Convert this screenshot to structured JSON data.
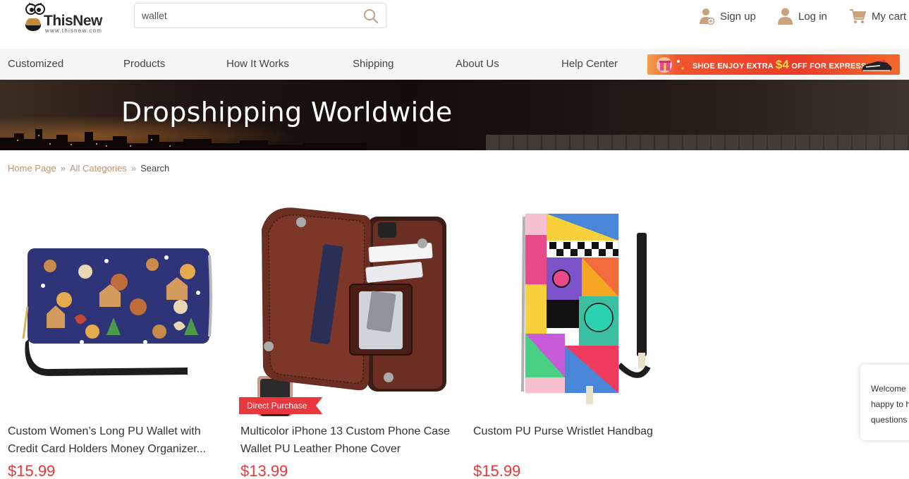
{
  "header": {
    "logo_brand": "ThisNew",
    "logo_url": "www.thisnew.com",
    "search_value": "wallet",
    "sign_up": "Sign up",
    "log_in": "Log in",
    "my_cart": "My cart"
  },
  "nav": {
    "items": [
      "Customized",
      "Products",
      "How It Works",
      "Shipping",
      "About Us",
      "Help Center"
    ],
    "promo": {
      "text_before": "SHOE ENJOY EXTRA ",
      "amount": "$4",
      "text_after": " OFF FOR EXPRESS"
    }
  },
  "banner": {
    "title": "Dropshipping Worldwide"
  },
  "breadcrumb": {
    "home": "Home Page",
    "separator": "»",
    "categories": "All Categories",
    "current": "Search"
  },
  "products": [
    {
      "title_line1": "Custom Women’s Long PU Wallet with",
      "title_line2": "Credit Card Holders Money Organizer...",
      "price": "$15.99",
      "badge": ""
    },
    {
      "title_line1": "Multicolor iPhone 13 Custom Phone Case",
      "title_line2": "Wallet PU Leather Phone Cover",
      "price": "$13.99",
      "badge": "Direct Purchase"
    },
    {
      "title_line1": "Custom PU Purse Wristlet Handbag",
      "title_line2": "",
      "price": "$15.99",
      "badge": ""
    }
  ],
  "chat": {
    "line1": "Welcome",
    "line2": "happy to h",
    "line3": "questions"
  },
  "colors": {
    "accent_link": "#bf9270",
    "price_red": "#e33a3a",
    "nav_bg": "#f5f5f5",
    "icon_tan": "#c9a27e"
  },
  "icons": {
    "search": "search-icon",
    "sign_up": "user-plus-icon",
    "log_in": "user-icon",
    "cart": "cart-icon"
  }
}
